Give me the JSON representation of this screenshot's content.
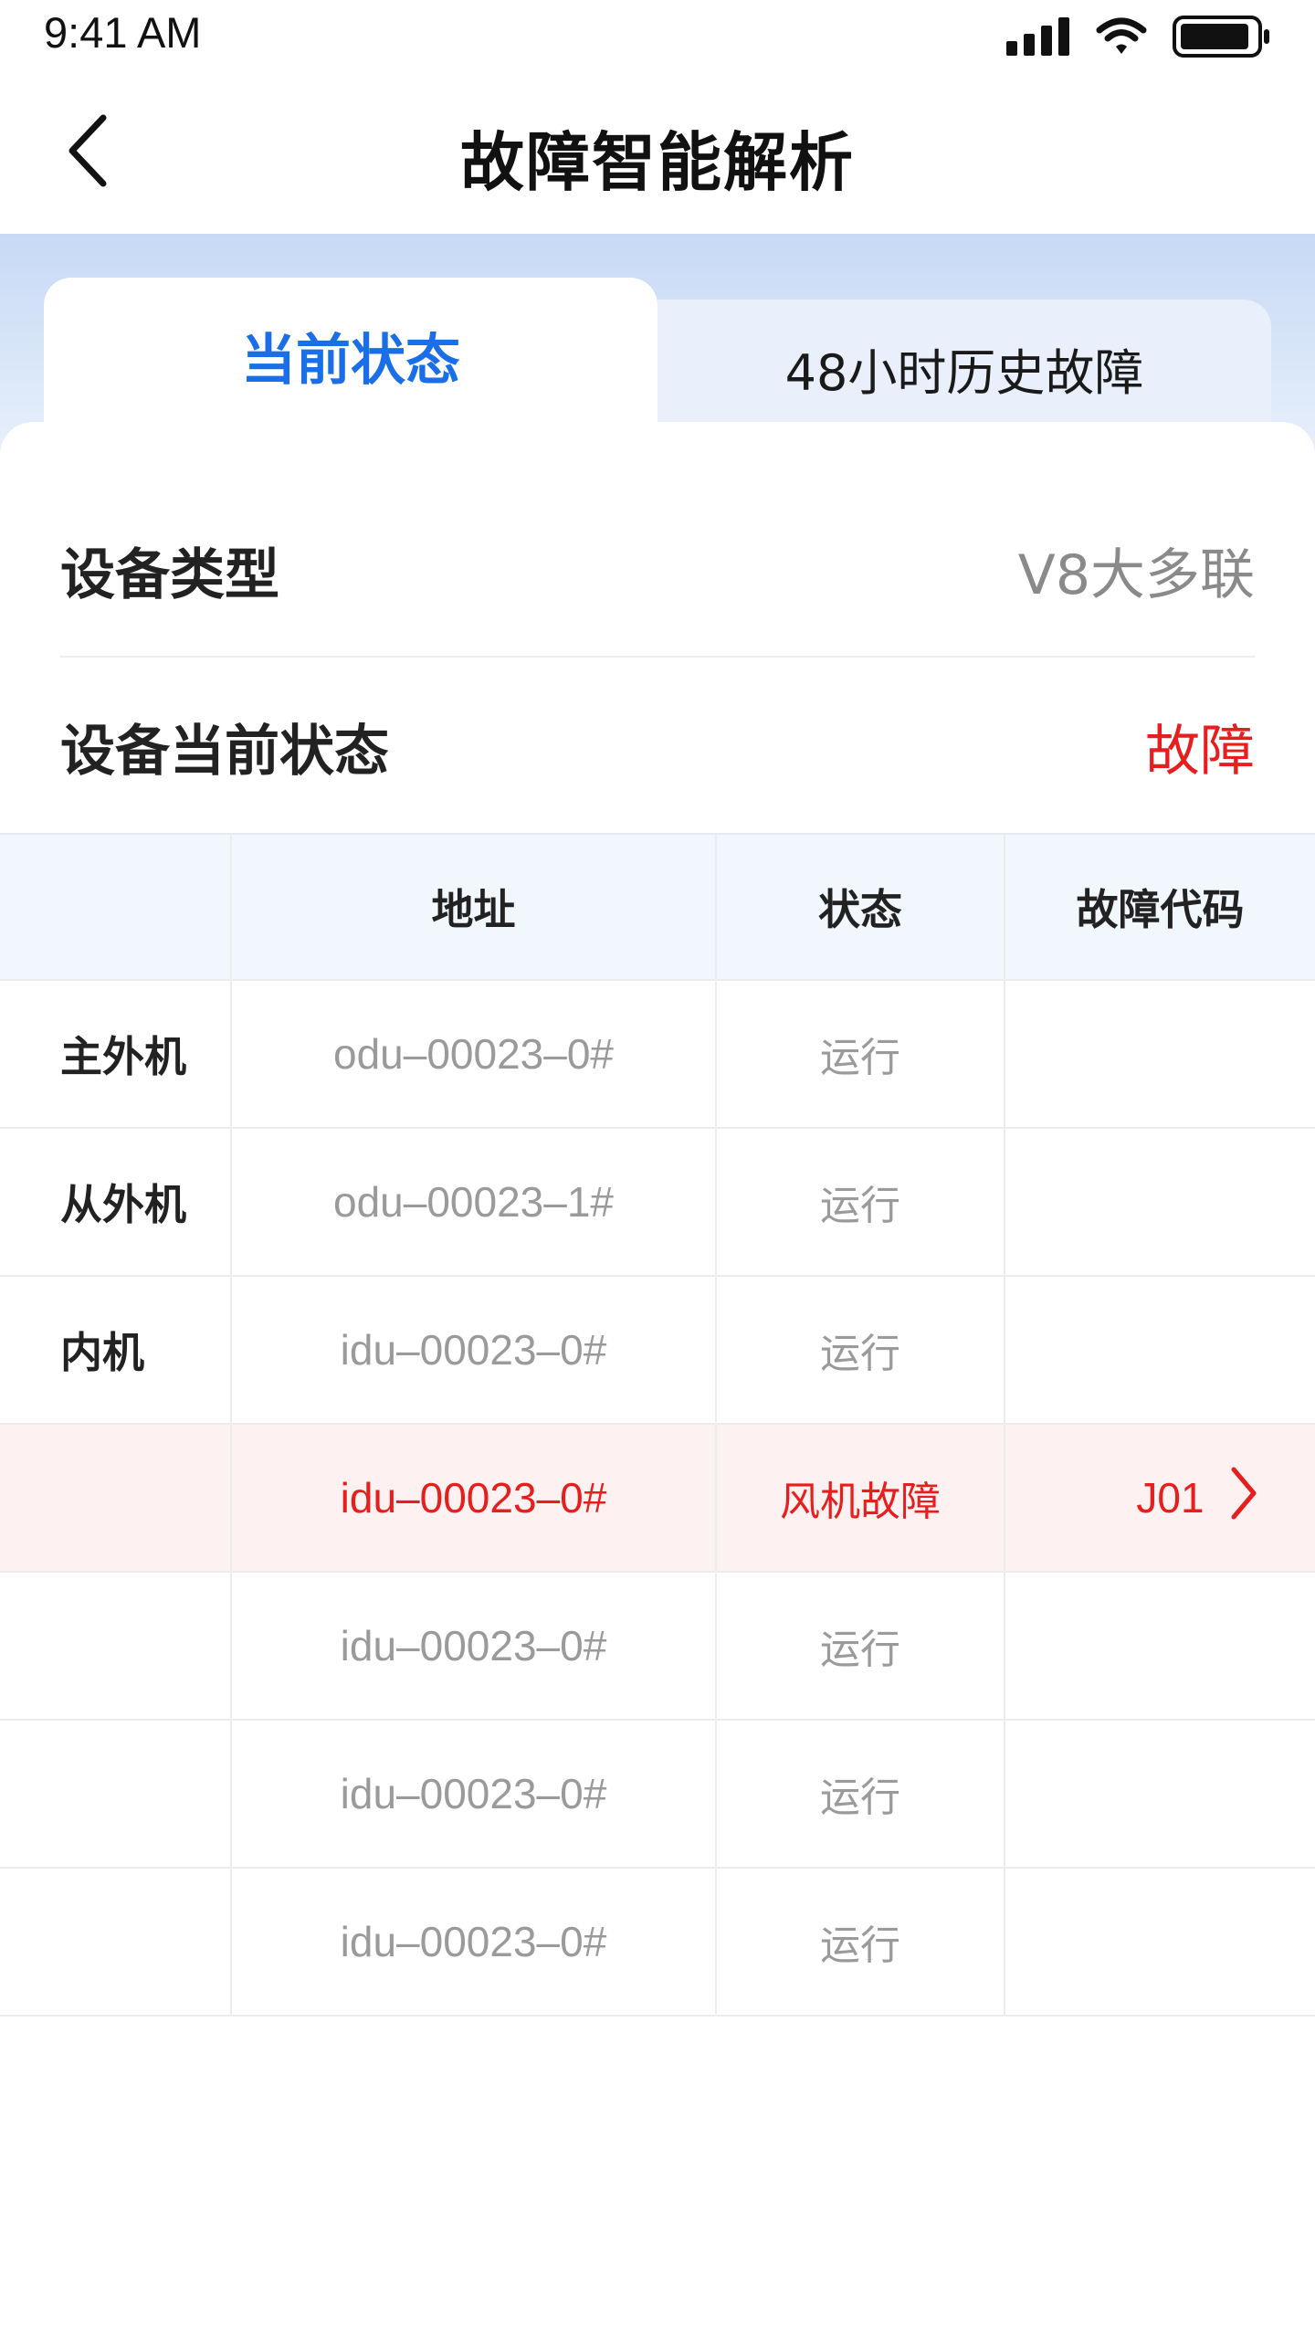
{
  "status_bar": {
    "time": "9:41 AM",
    "icons": [
      "signal-icon",
      "wifi-icon",
      "battery-icon"
    ]
  },
  "nav": {
    "title": "故障智能解析",
    "back_icon": "chevron-left-icon"
  },
  "tabs": [
    {
      "label": "当前状态",
      "active": true
    },
    {
      "label": "48小时历史故障",
      "active": false
    }
  ],
  "info": {
    "device_type_label": "设备类型",
    "device_type_value": "V8大多联",
    "current_status_label": "设备当前状态",
    "current_status_value": "故障"
  },
  "table": {
    "headers": [
      "",
      "地址",
      "状态",
      "故障代码"
    ],
    "rows": [
      {
        "type": "主外机",
        "address": "odu–00023–0#",
        "status": "运行",
        "code": "",
        "fault": false
      },
      {
        "type": "从外机",
        "address": "odu–00023–1#",
        "status": "运行",
        "code": "",
        "fault": false
      },
      {
        "type": "内机",
        "address": "idu–00023–0#",
        "status": "运行",
        "code": "",
        "fault": false
      },
      {
        "type": "",
        "address": "idu–00023–0#",
        "status": "风机故障",
        "code": "J01",
        "fault": true
      },
      {
        "type": "",
        "address": "idu–00023–0#",
        "status": "运行",
        "code": "",
        "fault": false
      },
      {
        "type": "",
        "address": "idu–00023–0#",
        "status": "运行",
        "code": "",
        "fault": false
      },
      {
        "type": "",
        "address": "idu–00023–0#",
        "status": "运行",
        "code": "",
        "fault": false
      }
    ]
  },
  "colors": {
    "accent": "#1a6fe8",
    "fault": "#e61e1e",
    "header_band": "#c7d9f5",
    "table_head_bg": "#f2f6fd",
    "fault_row_bg": "#fdf1f1"
  }
}
